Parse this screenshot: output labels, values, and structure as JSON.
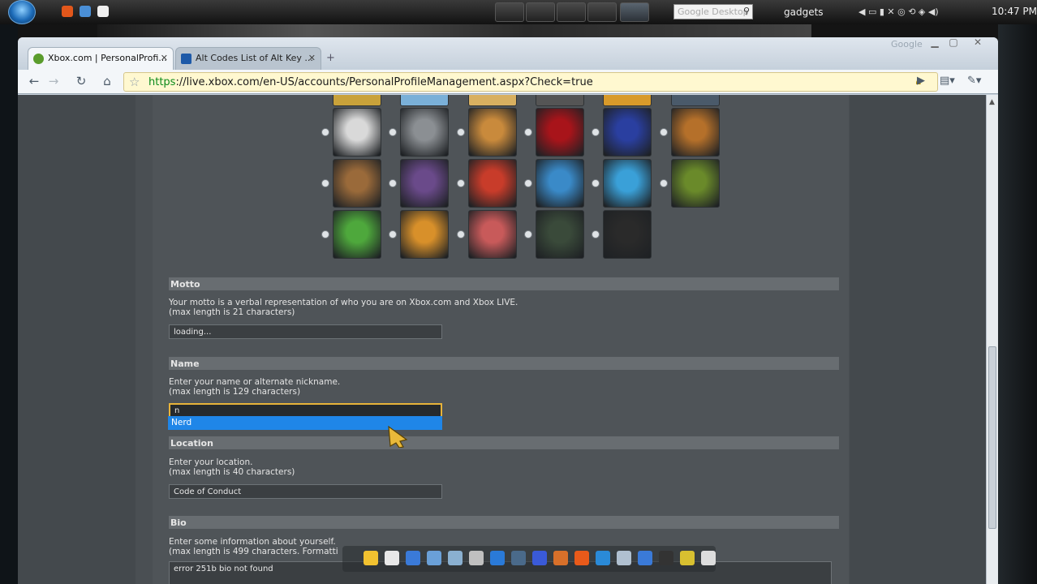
{
  "taskbar": {
    "search_placeholder": "Google Desktop",
    "gadgets_label": "gadgets",
    "clock": "10:47 PM"
  },
  "browser": {
    "brand_label": "Google",
    "tabs": [
      {
        "label": "Xbox.com | PersonalProfi...",
        "active": true
      },
      {
        "label": "Alt Codes List of Alt Key ...",
        "active": false
      }
    ],
    "url_scheme": "https",
    "url_rest": "://live.xbox.com/en-US/accounts/PersonalProfileManagement.aspx?Check=true"
  },
  "page": {
    "avatar_icons": [
      "skull-gamerpic-icon",
      "knight-gamerpic-icon",
      "warrior-gamerpic-icon",
      "crimson-omen-gamerpic-icon",
      "red-spartan-gamerpic-icon",
      "soldier-gamerpic-icon",
      "bandit-gamerpic-icon",
      "heroine-gamerpic-icon",
      "red-dragon-gamerpic-icon",
      "blue-monster-gamerpic-icon",
      "blue-alien-gamerpic-icon",
      "green-goblin-gamerpic-icon",
      "green-frog-gamerpic-icon",
      "orange-bug-gamerpic-icon",
      "red-hair-gamerpic-icon",
      "dark-hair-gamerpic-icon",
      "racing-helmet-gamerpic-icon"
    ],
    "motto": {
      "title": "Motto",
      "desc1": "Your motto is a verbal representation of who you are on Xbox.com and Xbox LIVE.",
      "desc2": "(max length is 21 characters)",
      "value": "loading..."
    },
    "name": {
      "title": "Name",
      "desc1": "Enter your name or alternate nickname.",
      "desc2": "(max length is 129 characters)",
      "value": "n",
      "suggestion": "Nerd"
    },
    "location": {
      "title": "Location",
      "desc1": "Enter your location.",
      "desc2": "(max length is 40 characters)",
      "value": "Code of Conduct"
    },
    "bio": {
      "title": "Bio",
      "desc1": "Enter some information about yourself.",
      "desc2": "(max length is 499 characters. Formatti",
      "value": "error 251b bio not found"
    }
  },
  "colors": {
    "accent_field_border": "#e7b33a",
    "suggestion_bg": "#1f86e8",
    "url_secure": "#0a8a1a"
  }
}
